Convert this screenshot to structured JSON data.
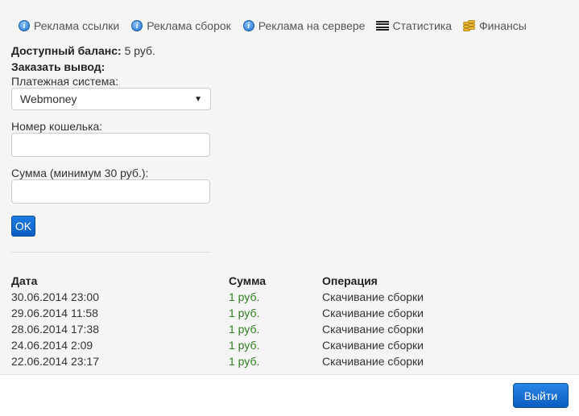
{
  "nav": {
    "items": [
      {
        "label": "Реклама ссылки",
        "icon": "info-icon"
      },
      {
        "label": "Реклама сборок",
        "icon": "info-icon"
      },
      {
        "label": "Реклама на сервере",
        "icon": "info-icon"
      },
      {
        "label": "Статистика",
        "icon": "list-icon"
      },
      {
        "label": "Финансы",
        "icon": "coins-icon"
      }
    ]
  },
  "balance": {
    "label": "Доступный баланс:",
    "value": "5 руб."
  },
  "withdraw": {
    "title": "Заказать вывод:",
    "payment_label": "Платежная система:",
    "payment_value": "Webmoney",
    "wallet_label": "Номер кошелька:",
    "wallet_value": "",
    "amount_label": "Сумма (минимум 30 руб.):",
    "amount_value": "",
    "ok_label": "OK"
  },
  "history": {
    "headers": [
      "Дата",
      "Сумма",
      "Операция"
    ],
    "rows": [
      [
        "30.06.2014 23:00",
        "1 руб.",
        "Скачивание сборки"
      ],
      [
        "29.06.2014 11:58",
        "1 руб.",
        "Скачивание сборки"
      ],
      [
        "28.06.2014 17:38",
        "1 руб.",
        "Скачивание сборки"
      ],
      [
        "24.06.2014 2:09",
        "1 руб.",
        "Скачивание сборки"
      ],
      [
        "22.06.2014 23:17",
        "1 руб.",
        "Скачивание сборки"
      ]
    ]
  },
  "footer": {
    "exit_label": "Выйти"
  },
  "colors": {
    "accent": "#0b5bc0",
    "amount": "#2e7d1e"
  }
}
